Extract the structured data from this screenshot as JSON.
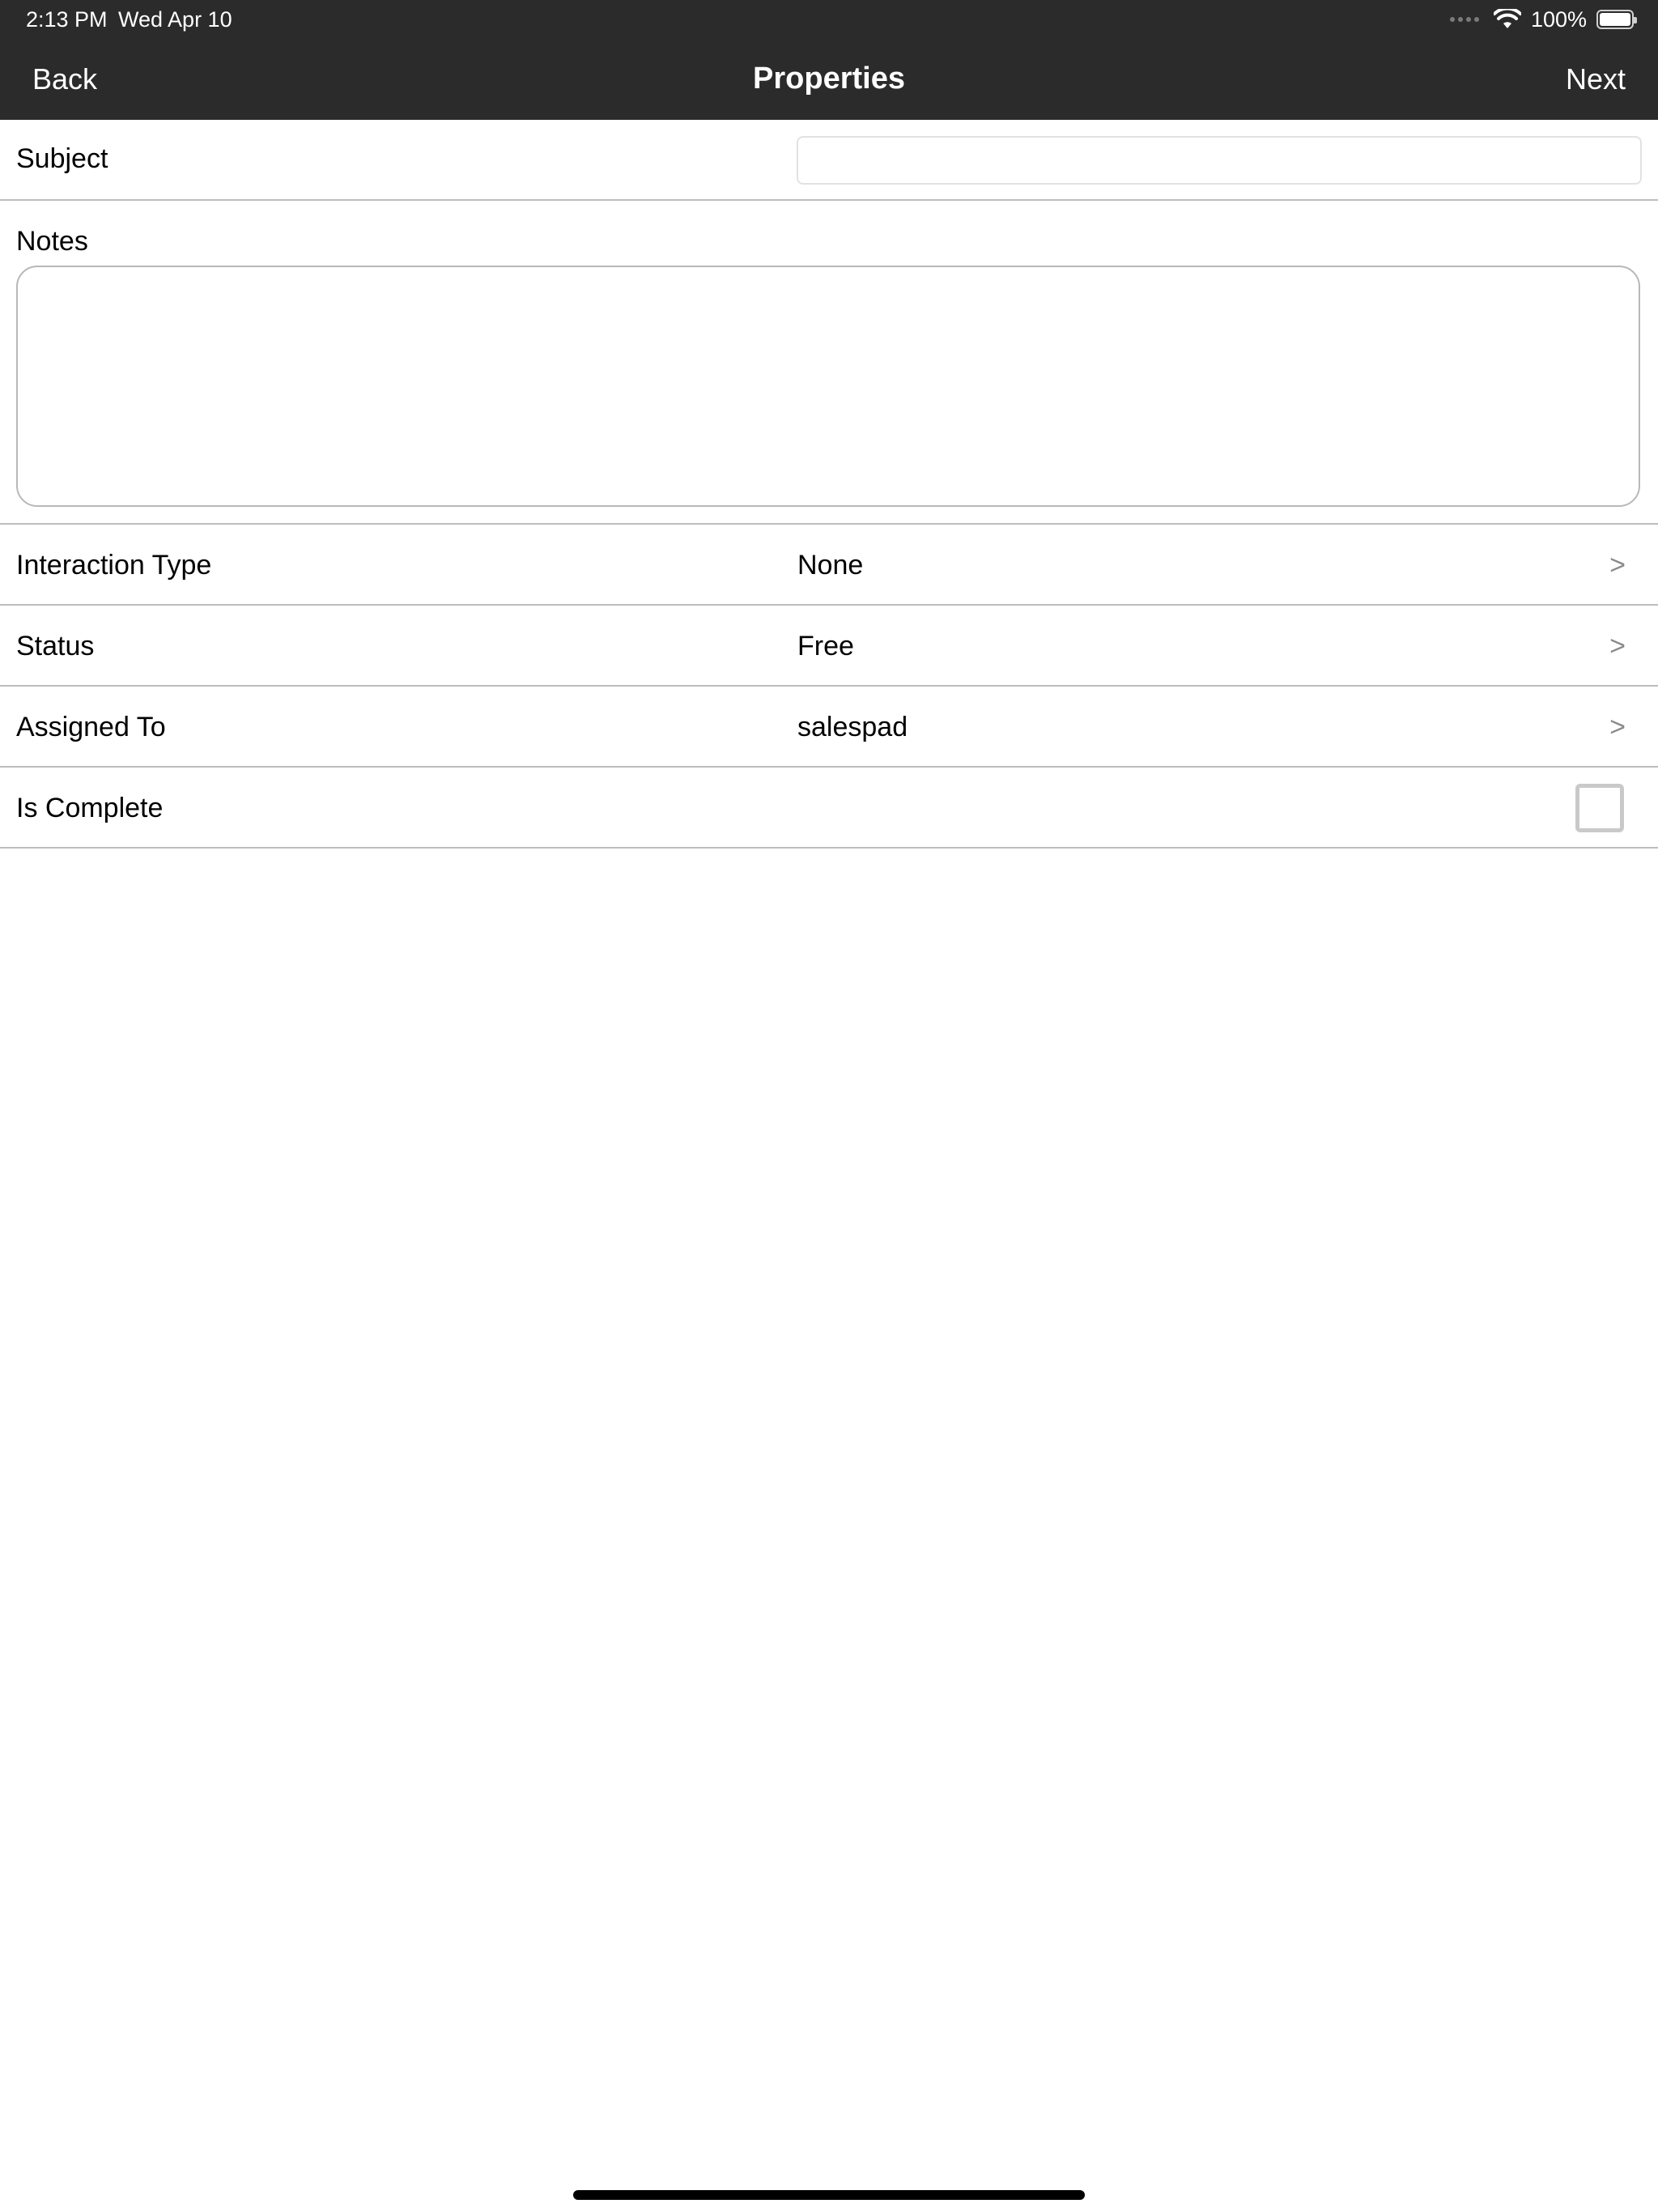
{
  "status_bar": {
    "time": "2:13 PM",
    "date": "Wed Apr 10",
    "battery_percent": "100%"
  },
  "nav": {
    "back_label": "Back",
    "title": "Properties",
    "next_label": "Next"
  },
  "form": {
    "subject": {
      "label": "Subject",
      "value": "",
      "placeholder": ""
    },
    "notes": {
      "label": "Notes",
      "value": ""
    },
    "interaction_type": {
      "label": "Interaction Type",
      "value": "None",
      "chevron": ">"
    },
    "status": {
      "label": "Status",
      "value": "Free",
      "chevron": ">"
    },
    "assigned_to": {
      "label": "Assigned To",
      "value": "salespad",
      "chevron": ">"
    },
    "is_complete": {
      "label": "Is Complete",
      "checked": false
    }
  },
  "colors": {
    "nav_background": "#2b2b2b",
    "divider": "#bdbdbd",
    "chevron": "#8a8a8a"
  }
}
